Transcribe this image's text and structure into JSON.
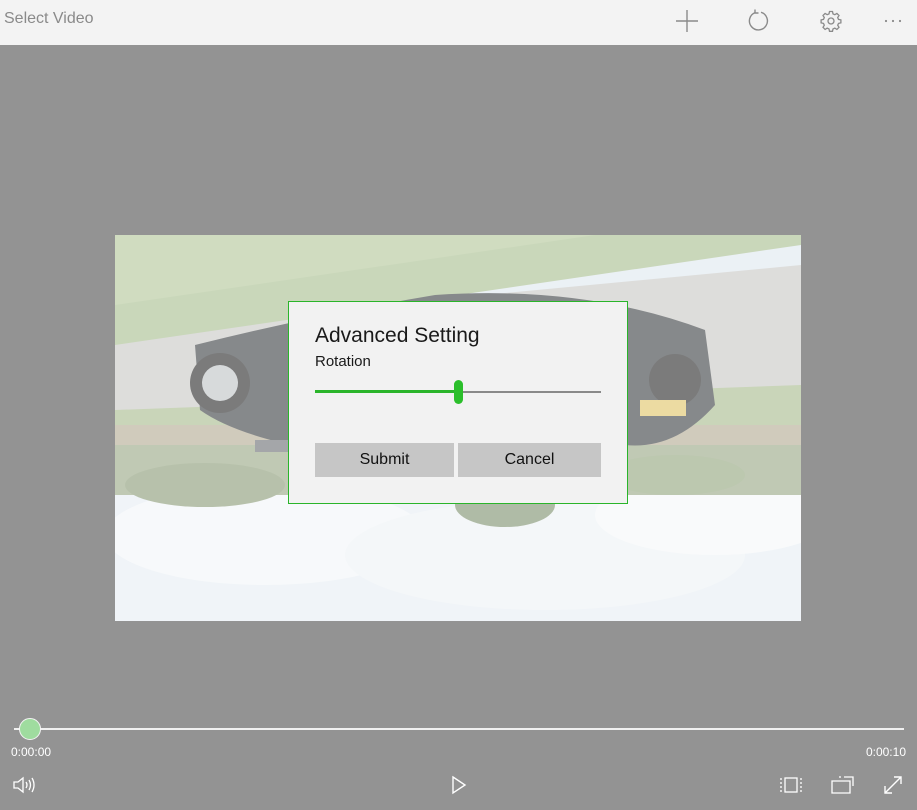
{
  "header": {
    "title": "Select Video",
    "buttons": [
      "add-icon",
      "rotate-icon",
      "gear-icon",
      "more-icon"
    ]
  },
  "dialog": {
    "title": "Advanced Setting",
    "rotation_label": "Rotation",
    "rotation_value_fraction": 0.5,
    "submit_label": "Submit",
    "cancel_label": "Cancel",
    "accent_color": "#2bb52b"
  },
  "player": {
    "current_time": "0:00:00",
    "total_time": "0:00:10",
    "progress_fraction": 0.0,
    "controls": [
      "volume-icon",
      "play-icon",
      "aspect-ratio-icon",
      "cast-icon",
      "fullscreen-icon"
    ]
  }
}
